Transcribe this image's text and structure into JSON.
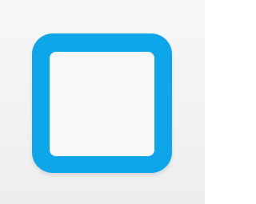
{
  "icon": {
    "name": "checkbox-square-icon",
    "background_color": "#f7f7f7",
    "background_gradient_bottom": "#eeeeee",
    "frame_color": "#0ea6ea",
    "inner_color": "#f8f8f8"
  }
}
